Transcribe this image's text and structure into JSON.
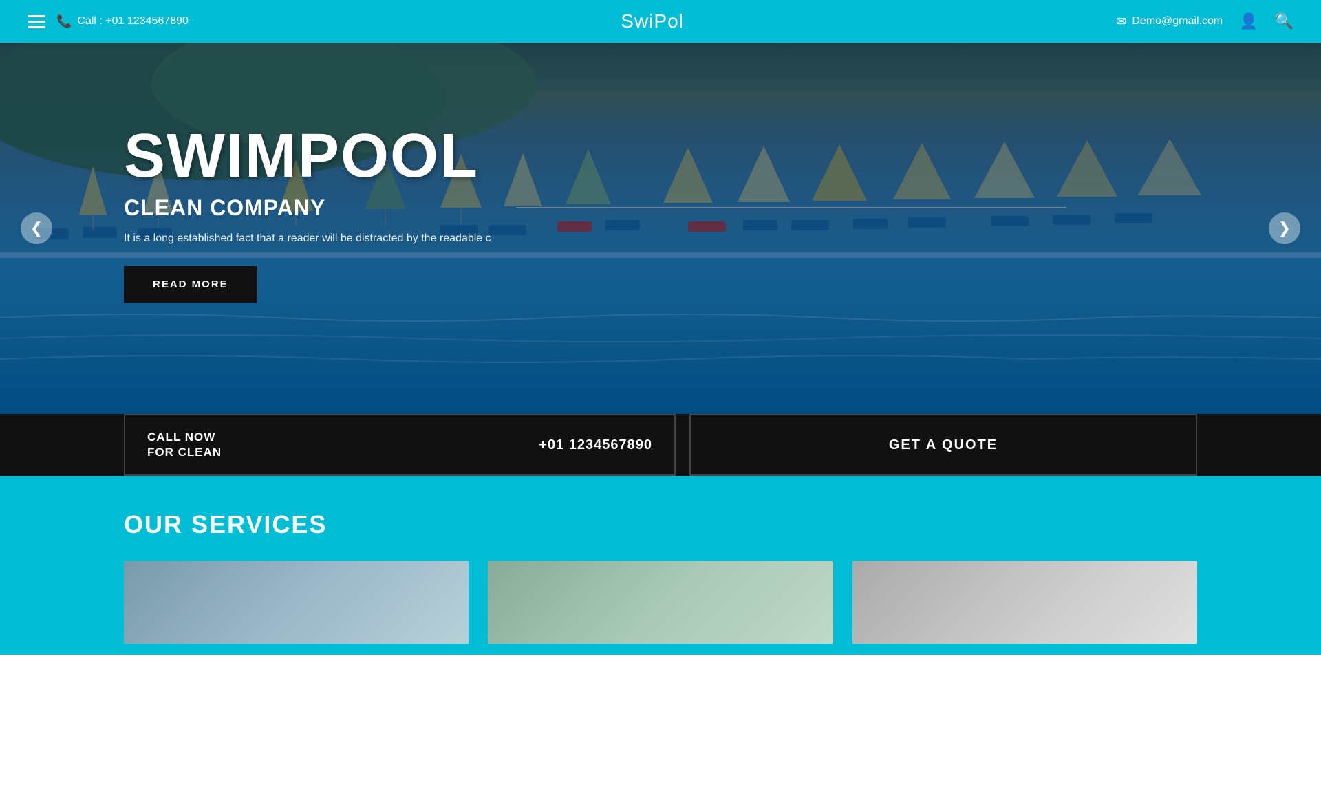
{
  "header": {
    "phone_icon": "📞",
    "phone_label": "Call : +01 1234567890",
    "logo_part1": "Swi",
    "logo_part2": "Pol",
    "email_icon": "✉",
    "email_label": "Demo@gmail.com",
    "user_icon": "👤",
    "search_icon": "🔍"
  },
  "hero": {
    "title": "SWIMPOOL",
    "subtitle": "CLEAN COMPANY",
    "description": "It is a long established fact that a reader will be distracted by the readable c",
    "read_more_label": "READ MORE",
    "arrow_left": "❮",
    "arrow_right": "❯"
  },
  "cta_bar": {
    "call_now": "CALL NOW",
    "for_clean": "FOR CLEAN",
    "phone": "+01 1234567890",
    "quote_label": "GET A QUOTE"
  },
  "services": {
    "title": "OUR SERVICES",
    "cards": [
      {
        "id": 1
      },
      {
        "id": 2
      },
      {
        "id": 3
      }
    ]
  }
}
